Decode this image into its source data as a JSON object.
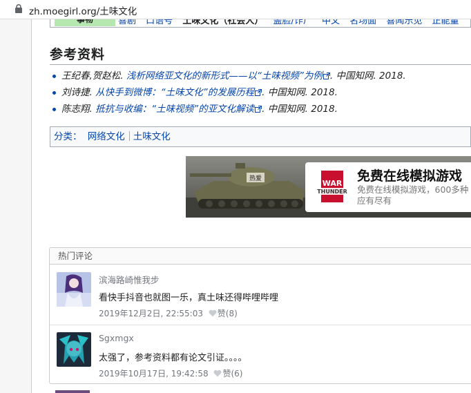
{
  "browser": {
    "url": "zh.moegirl.org/土味文化"
  },
  "navbox": {
    "group": "事物",
    "items": [
      {
        "label": "喜剧",
        "selected": false
      },
      {
        "label": "口语号",
        "selected": false
      },
      {
        "label": "土味文化（社会人）",
        "selected": true
      },
      {
        "label": "盖脸/诈尸",
        "selected": false
      },
      {
        "label": "中文",
        "selected": false
      },
      {
        "label": "名场面",
        "selected": false
      },
      {
        "label": "喜闻乐见",
        "selected": false
      },
      {
        "label": "正能量",
        "selected": false
      }
    ]
  },
  "section": {
    "title": "参考资料"
  },
  "references": [
    {
      "author": "王纪春,贺赵松",
      "title": "浅析网络亚文化的新形式——以“土味视频”为例",
      "source": ". 中国知网. 2018."
    },
    {
      "author": "刘诗捷",
      "title": "从快手到微博：“土味文化”的发展历程",
      "source": ". 中国知网. 2018."
    },
    {
      "author": "陈志翔",
      "title": "抵抗与收编：“土味视频”的亚文化解读",
      "source": ". 中国知网. 2018."
    }
  ],
  "categories": {
    "label": "分类：",
    "items": [
      "网络文化",
      "土味文化"
    ]
  },
  "ad": {
    "brand": "WAR THUNDER",
    "title": "免费在线模拟游戏",
    "description": "免费在线模拟游戏，600多种应有尽有",
    "tank_marking": "热爱"
  },
  "comments_section": {
    "title": "热门评论",
    "comments": [
      {
        "user": "滨海路崎惟我步",
        "text": "看快手抖音也就图一乐，真土味还得哔哩哔哩",
        "time": "2019年12月2日, 22:55:03",
        "likes": "赞(8)"
      },
      {
        "user": "Sgxmgx",
        "text": "太强了，参考资料都有论文引证。。。。",
        "time": "2019年10月17日, 19:42:58",
        "likes": "赞(6)"
      }
    ]
  },
  "colors": {
    "link": "#0645ad",
    "navbox_group_bg": "#b6e7b0",
    "border": "#a2a9b1"
  }
}
